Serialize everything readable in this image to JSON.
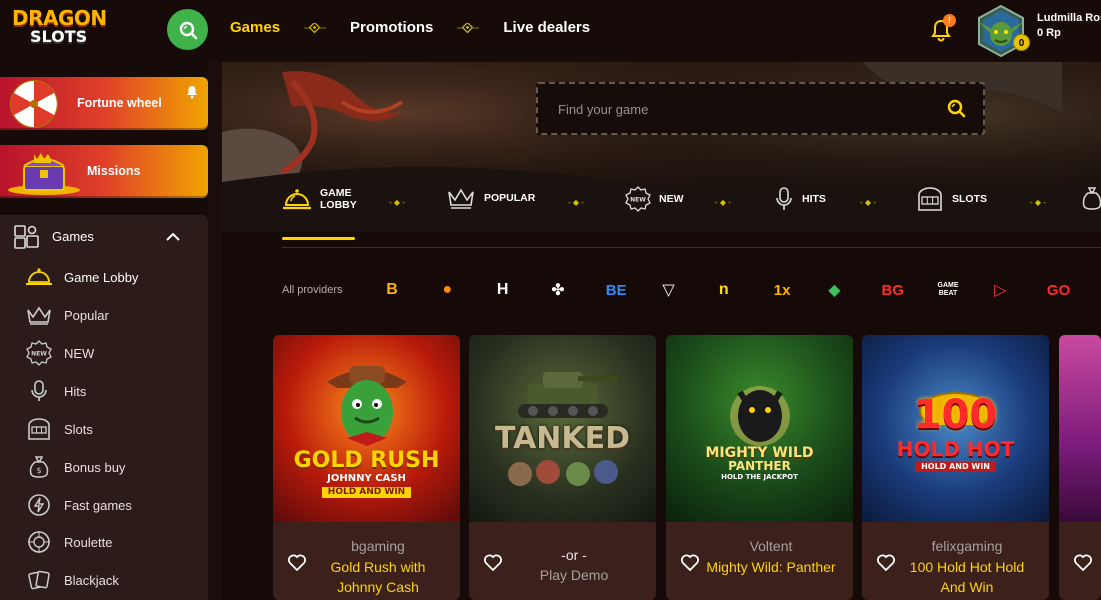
{
  "header": {
    "logo_line1": "DRAGON",
    "logo_line2": "SLOTS",
    "nav": [
      "Games",
      "Promotions",
      "Live dealers"
    ],
    "notification_count": "!",
    "user_name": "Ludmilla Ros",
    "balance": "0 Rp",
    "coin_count": "0"
  },
  "sidebar": {
    "promos": [
      "Fortune wheel",
      "Missions"
    ],
    "section_title": "Games",
    "items": [
      {
        "label": "Game Lobby",
        "icon": "bell-lobby-icon"
      },
      {
        "label": "Popular",
        "icon": "crown-icon"
      },
      {
        "label": "NEW",
        "icon": "new-badge-icon"
      },
      {
        "label": "Hits",
        "icon": "microphone-icon"
      },
      {
        "label": "Slots",
        "icon": "slot-machine-icon"
      },
      {
        "label": "Bonus buy",
        "icon": "money-bag-icon"
      },
      {
        "label": "Fast games",
        "icon": "lightning-icon"
      },
      {
        "label": "Roulette",
        "icon": "roulette-icon"
      },
      {
        "label": "Blackjack",
        "icon": "cards-icon"
      }
    ]
  },
  "search": {
    "placeholder": "Find your game"
  },
  "categories": [
    {
      "line1": "GAME",
      "line2": "LOBBY",
      "icon": "bell-lobby-icon"
    },
    {
      "line1": "POPULAR",
      "line2": "",
      "icon": "crown-icon"
    },
    {
      "line1": "NEW",
      "line2": "",
      "icon": "new-badge-icon"
    },
    {
      "line1": "HITS",
      "line2": "",
      "icon": "microphone-icon"
    },
    {
      "line1": "SLOTS",
      "line2": "",
      "icon": "slot-machine-icon"
    }
  ],
  "providers": {
    "label": "All providers",
    "logos": [
      {
        "text": "B",
        "color": "#ffb400"
      },
      {
        "text": "●",
        "color": "#ff8a00"
      },
      {
        "text": "H",
        "color": "#ffffff"
      },
      {
        "text": "✤",
        "color": "#ffffff"
      },
      {
        "text": "BE",
        "color": "#2a8cff"
      },
      {
        "text": "▽",
        "color": "#ffffff"
      },
      {
        "text": "n",
        "color": "#ffe000"
      },
      {
        "text": "1x",
        "color": "#ffb400"
      },
      {
        "text": "◆",
        "color": "#3fbf5a"
      },
      {
        "text": "BG",
        "color": "#ff2a2a"
      },
      {
        "text": "GAME BEAT",
        "color": "#ffffff"
      },
      {
        "text": "▷",
        "color": "#ff2a4a"
      },
      {
        "text": "GO",
        "color": "#ff2a2a"
      }
    ]
  },
  "games": [
    {
      "provider": "bgaming",
      "name": "Gold Rush with Johnny Cash",
      "art_title": "GOLD RUSH",
      "art_sub": "JOHNNY CASH",
      "art_tag": "HOLD AND WIN",
      "type": "normal"
    },
    {
      "provider": "",
      "name": "",
      "art_title": "TANKED",
      "art_sub": "",
      "art_tag": "",
      "type": "demo",
      "or": "-or -",
      "demo": "Play Demo"
    },
    {
      "provider": "Voltent",
      "name": "Mighty Wild: Panther",
      "art_title": "MIGHTY WILD",
      "art_sub": "PANTHER",
      "art_tag": "HOLD THE JACKPOT",
      "type": "normal"
    },
    {
      "provider": "felixgaming",
      "name": "100 Hold Hot Hold And Win",
      "art_title": "100",
      "art_sub": "HOLD HOT",
      "art_tag": "HOLD AND WIN",
      "type": "normal"
    }
  ]
}
